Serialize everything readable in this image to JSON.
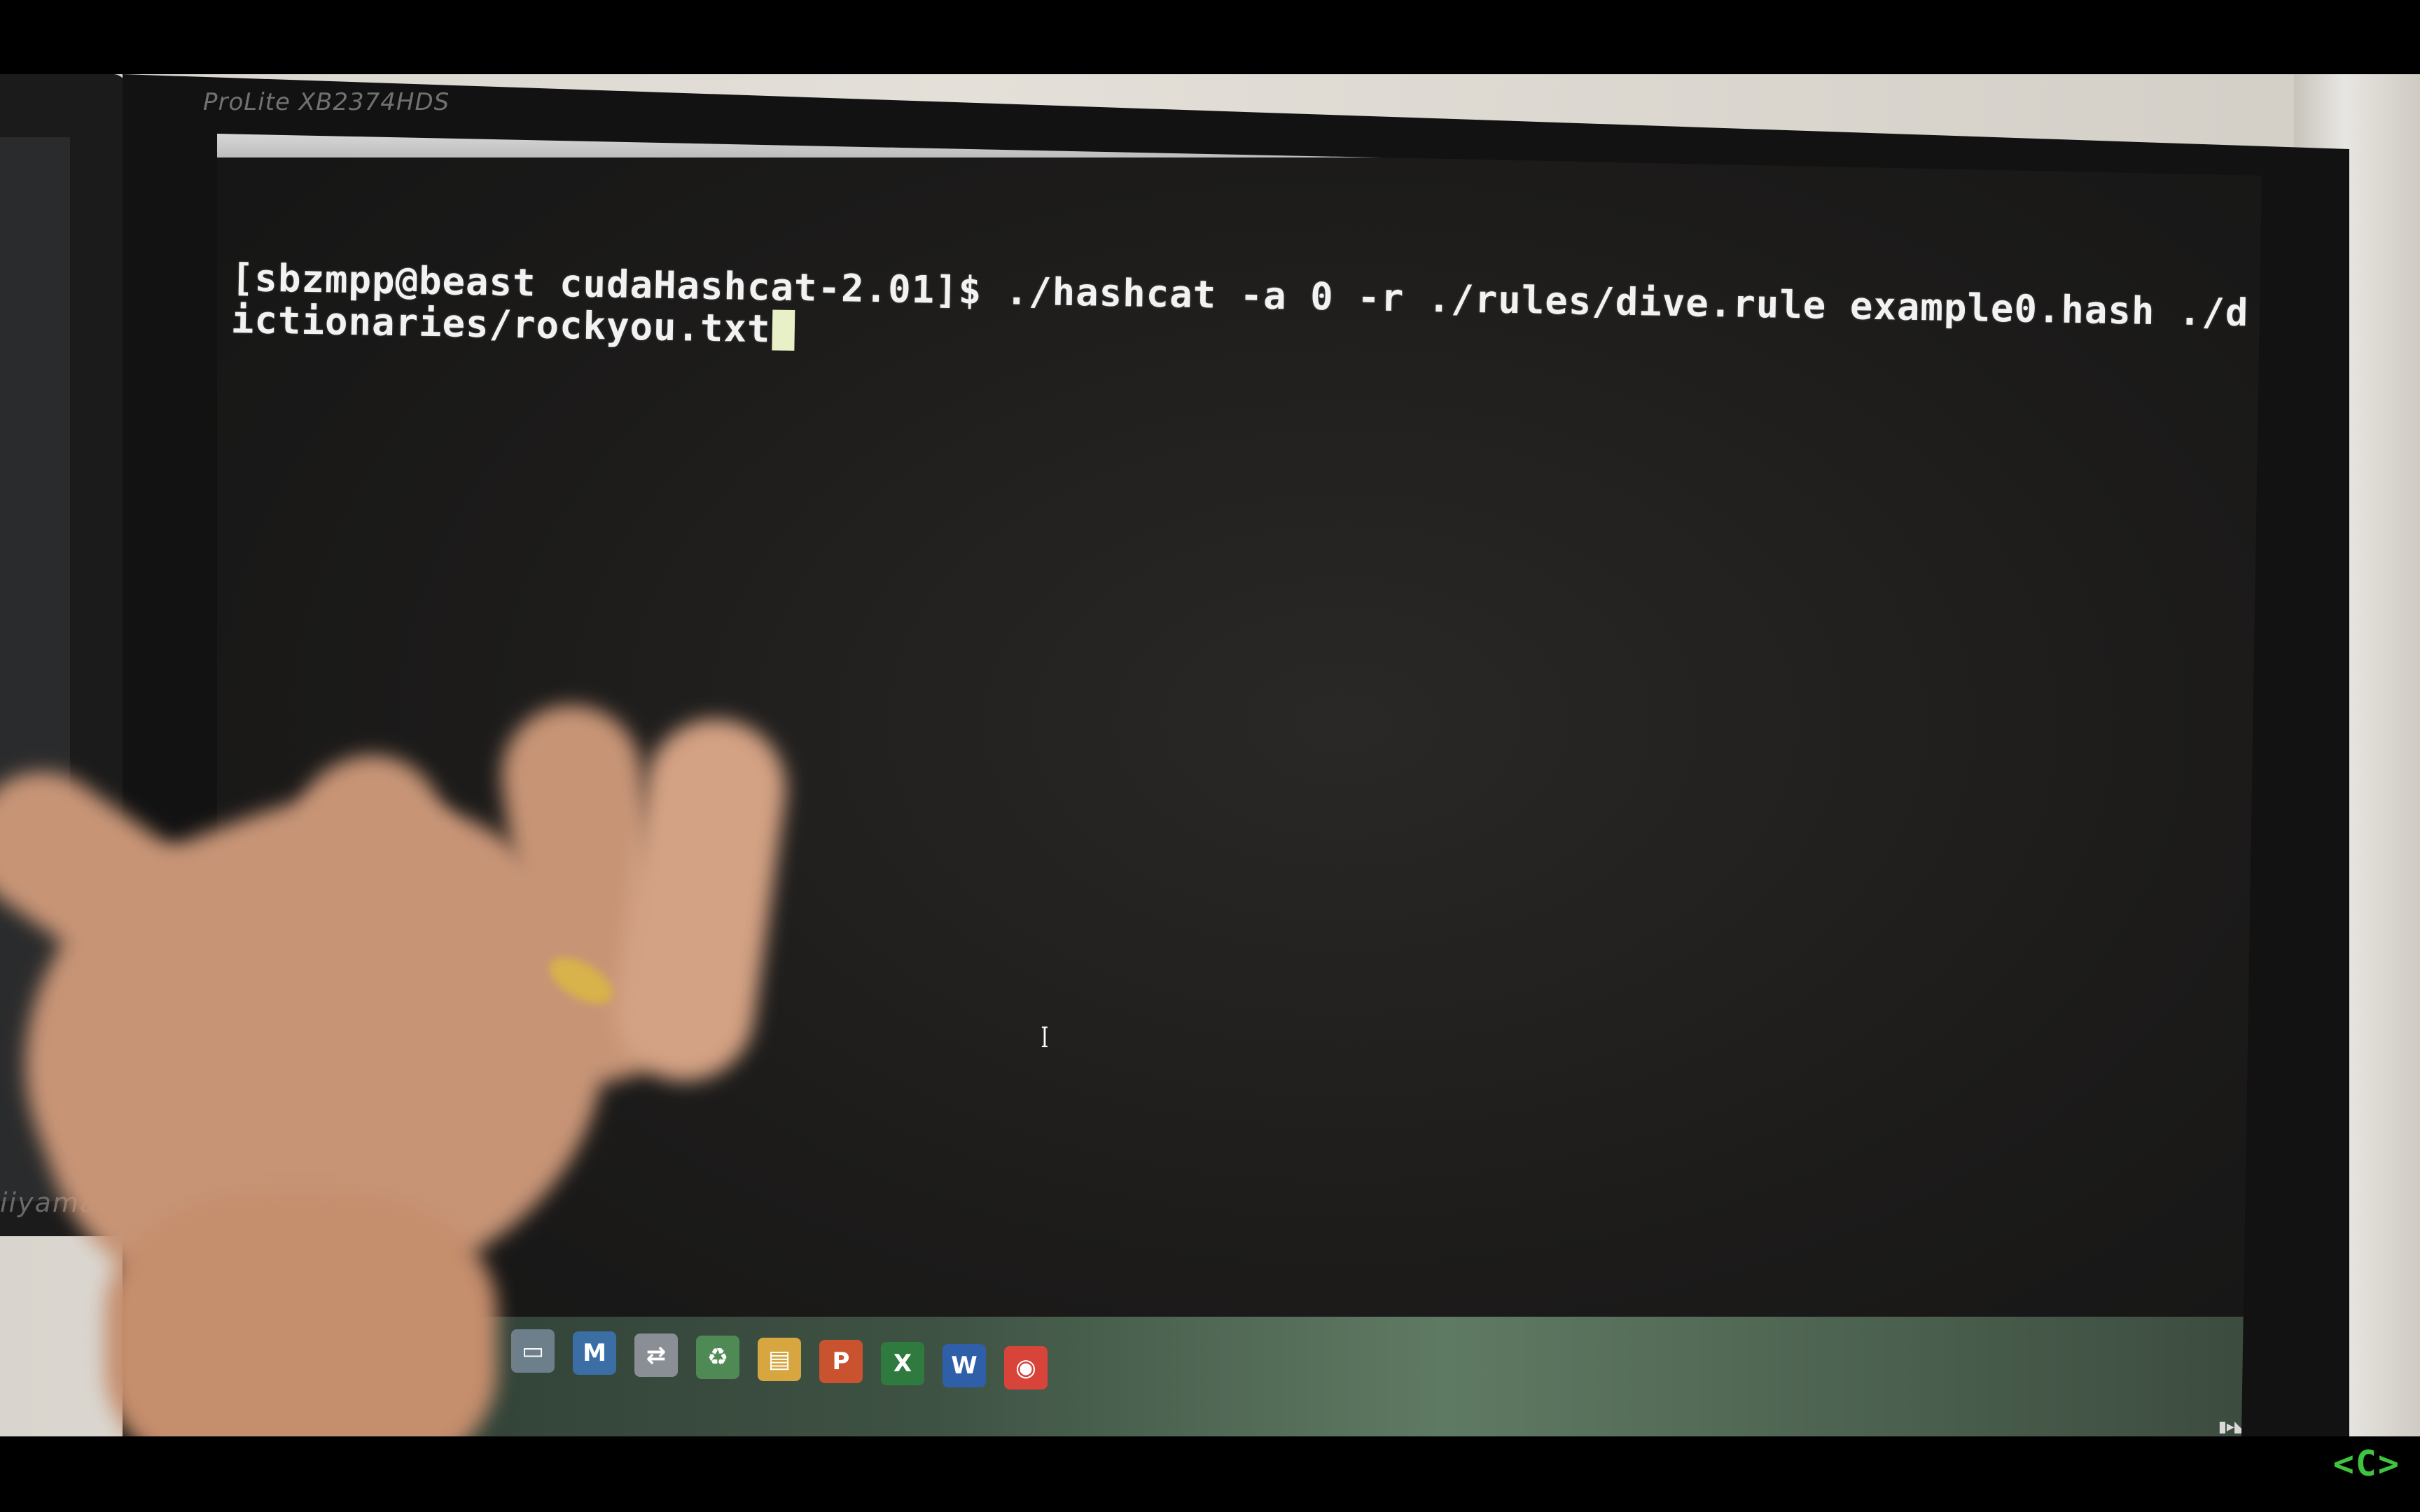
{
  "monitor": {
    "brand_label": "ProLite XB2374HDS",
    "left_monitor_brand": "iiyama"
  },
  "terminal": {
    "line1": "[sbzmpp@beast cudaHashcat-2.01]$ ./hashcat -a 0 -r ./rules/dive.rule example0.hash ./d",
    "line2": "ictionaries/rockyou.txt",
    "text_color": "#f2f2f2",
    "background": "#1c1b1a"
  },
  "mouse_pointer": "I",
  "taskbar": {
    "icons": [
      {
        "name": "files-icon",
        "glyph": "▭",
        "color": "#6e7f8c"
      },
      {
        "name": "matlab-icon",
        "glyph": "M",
        "color": "#3a6ea5"
      },
      {
        "name": "network-icon",
        "glyph": "⇄",
        "color": "#8a8f96"
      },
      {
        "name": "recycle-icon",
        "glyph": "♻",
        "color": "#4f8a55"
      },
      {
        "name": "folder-icon",
        "glyph": "▤",
        "color": "#d7a640"
      },
      {
        "name": "powerpoint-icon",
        "glyph": "P",
        "color": "#c9522f"
      },
      {
        "name": "excel-icon",
        "glyph": "X",
        "color": "#2f7b3f"
      },
      {
        "name": "word-icon",
        "glyph": "W",
        "color": "#2f5fa8"
      },
      {
        "name": "chrome-icon",
        "glyph": "◉",
        "color": "#d8443a"
      }
    ]
  },
  "channel_logo": "<C>"
}
